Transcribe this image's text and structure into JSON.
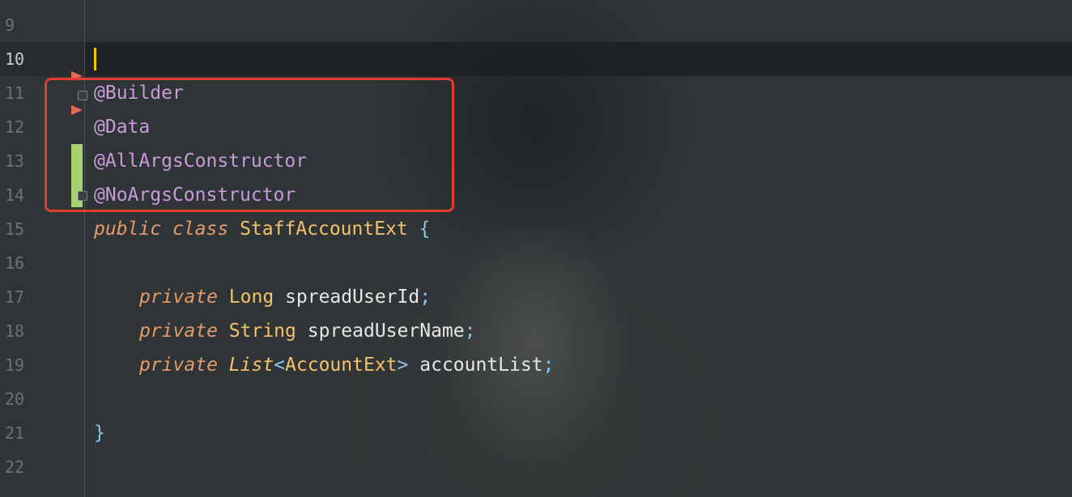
{
  "editor": {
    "line_numbers": [
      "9",
      "10",
      "11",
      "12",
      "13",
      "14",
      "15",
      "16",
      "17",
      "18",
      "19",
      "20",
      "21",
      "22"
    ],
    "current_line": "10",
    "annotations": [
      "@Builder",
      "@Data",
      "@AllArgsConstructor",
      "@NoArgsConstructor"
    ],
    "class_decl": {
      "modifier": "public",
      "keyword": "class",
      "name": "StaffAccountExt",
      "open": "{"
    },
    "fields": [
      {
        "modifier": "private",
        "type": "Long",
        "name": "spreadUserId",
        "end": ";"
      },
      {
        "modifier": "private",
        "type": "String",
        "name": "spreadUserName",
        "end": ";"
      },
      {
        "modifier": "private",
        "type": "List",
        "type_open": "<",
        "type_arg": "AccountExt",
        "type_close": ">",
        "name": "accountList",
        "end": ";"
      }
    ],
    "closing_brace": "}"
  },
  "colors": {
    "annotation": "#c79bdc",
    "keyword": "#e69a6a",
    "type": "#f3c26a",
    "identifier": "#e6e6e6",
    "punctuation": "#89c6f0",
    "caret": "#f5c400",
    "highlight_box": "#e23b2f",
    "change_marker": "#a8d172",
    "bookmark": "#e8665a"
  },
  "icons": [
    "bookmark-icon",
    "fold-icon",
    "change-marker"
  ]
}
